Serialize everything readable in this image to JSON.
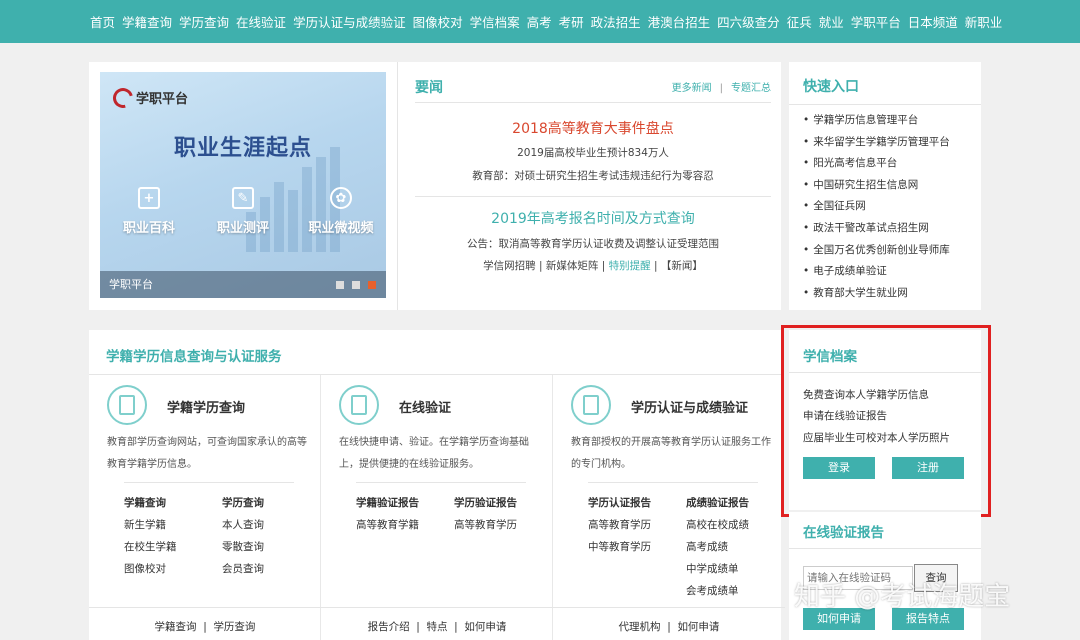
{
  "topnav": {
    "items": [
      "首页",
      "学籍查询",
      "学历查询",
      "在线验证",
      "学历认证与成绩验证",
      "图像校对",
      "学信档案",
      "高考",
      "考研",
      "政法招生",
      "港澳台招生",
      "四六级查分",
      "征兵",
      "就业",
      "学职平台",
      "日本频道",
      "新职业"
    ]
  },
  "banner": {
    "logo_text": "学职平台",
    "headline": "职业生涯起点",
    "features": [
      {
        "icon": "plus-doc-icon",
        "label": "职业百科"
      },
      {
        "icon": "edit-doc-icon",
        "label": "职业测评"
      },
      {
        "icon": "film-reel-icon",
        "label": "职业微视频"
      }
    ],
    "caption": "学职平台"
  },
  "news": {
    "title": "要闻",
    "more_link": "更多新闻",
    "topics_link": "专题汇总",
    "headline1": "2018高等教育大事件盘点",
    "sub1": "2019届高校毕业生预计834万人",
    "sub2": "教育部：对硕士研究生招生考试违规违纪行为零容忍",
    "headline2": "2019年高考报名时间及方式查询",
    "sub3": "公告：取消高等教育学历认证收费及调整认证受理范围",
    "links": {
      "a": "学信网招聘",
      "b": "新媒体矩阵",
      "c": "特别提醒",
      "d": "【新闻】"
    }
  },
  "quick": {
    "title": "快速入口",
    "items": [
      "学籍学历信息管理平台",
      "来华留学生学籍学历管理平台",
      "阳光高考信息平台",
      "中国研究生招生信息网",
      "全国征兵网",
      "政法干警改革试点招生网",
      "全国万名优秀创新创业导师库",
      "电子成绩单验证",
      "教育部大学生就业网"
    ]
  },
  "service": {
    "title": "学籍学历信息查询与认证服务",
    "cols": [
      {
        "name": "学籍学历查询",
        "desc": "教育部学历查询网站，可查询国家承认的高等教育学籍学历信息。",
        "cells": [
          "学籍查询",
          "学历查询",
          "新生学籍",
          "本人查询",
          "在校生学籍",
          "零散查询",
          "图像校对",
          "会员查询"
        ],
        "bottom": [
          "学籍查询",
          "学历查询"
        ]
      },
      {
        "name": "在线验证",
        "desc": "在线快捷申请、验证。在学籍学历查询基础上，提供便捷的在线验证服务。",
        "cells": [
          "学籍验证报告",
          "学历验证报告",
          "高等教育学籍",
          "高等教育学历"
        ],
        "bottom": [
          "报告介绍",
          "特点",
          "如何申请"
        ]
      },
      {
        "name": "学历认证与成绩验证",
        "desc": "教育部授权的开展高等教育学历认证服务工作的专门机构。",
        "cells": [
          "学历认证报告",
          "成绩验证报告",
          "高等教育学历",
          "高校在校成绩",
          "中等教育学历",
          "高考成绩",
          "",
          "中学成绩单",
          "",
          "会考成绩单"
        ],
        "bottom": [
          "代理机构",
          "如何申请"
        ]
      }
    ]
  },
  "archive": {
    "title": "学信档案",
    "items": [
      "免费查询本人学籍学历信息",
      "申请在线验证报告",
      "应届毕业生可校对本人学历照片"
    ],
    "login": "登录",
    "register": "注册"
  },
  "verify": {
    "title": "在线验证报告",
    "placeholder": "请输入在线验证码",
    "query": "查询",
    "how": "如何申请",
    "features": "报告特点"
  },
  "watermark": "知乎 @考试海题宝",
  "colors": {
    "accent": "#3fb0ad",
    "headline_red": "#d9482f",
    "highlight": "#e02020"
  }
}
